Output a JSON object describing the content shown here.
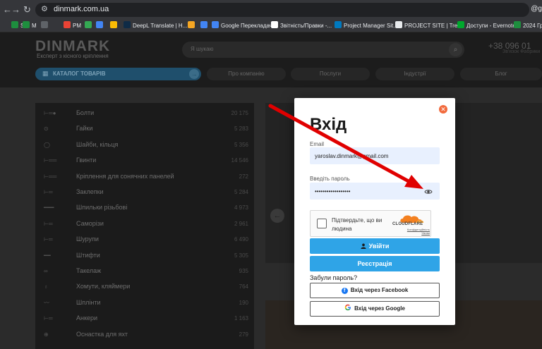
{
  "browser": {
    "url": "dinmark.com.ua",
    "account_label": "@g",
    "bookmarks": [
      {
        "label": "R",
        "color": "#35363a"
      },
      {
        "label": "S",
        "color": "#1e8e3e"
      },
      {
        "label": "M",
        "color": "#1e8e3e"
      },
      {
        "label": "",
        "color": "#5f6368"
      },
      {
        "label": "PM",
        "color": "#ea4335"
      },
      {
        "label": "",
        "color": "#34a853"
      },
      {
        "label": "",
        "color": "#4285f4"
      },
      {
        "label": "",
        "color": "#fbbc04"
      },
      {
        "label": "DeepL Translate | H...",
        "color": "#0f2b46"
      },
      {
        "label": "",
        "color": "#f5a623"
      },
      {
        "label": "",
        "color": "#4285f4"
      },
      {
        "label": "Google Перекладач",
        "color": "#4285f4"
      },
      {
        "label": "Звітність/Правки -...",
        "color": "#ffffff"
      },
      {
        "label": "Project Manager Sit...",
        "color": "#0079bf"
      },
      {
        "label": "PROJECT SITE | Trello",
        "color": "#e8eaed"
      },
      {
        "label": "Доступи - Evernote",
        "color": "#00a82d"
      },
      {
        "label": "2024 Граф",
        "color": "#1e8e3e"
      }
    ]
  },
  "site": {
    "logo": "DINMARK",
    "tagline": "Експерт з кісного кріплення",
    "search_placeholder": "Я шукаю",
    "phone": "+38 096 01",
    "phone_sub": "Зв'язок Фабрики",
    "catalog_label": "КАТАЛОГ ТОВАРІВ",
    "nav": [
      "Про компанію",
      "Послуги",
      "Індустрії",
      "Блог"
    ],
    "categories": [
      {
        "name": "Болти",
        "count": "20 175"
      },
      {
        "name": "Гайки",
        "count": "5 283"
      },
      {
        "name": "Шайби, кільця",
        "count": "5 356"
      },
      {
        "name": "Гвинти",
        "count": "14 546"
      },
      {
        "name": "Кріплення для сонячних панелей",
        "count": "272"
      },
      {
        "name": "Заклепки",
        "count": "5 284"
      },
      {
        "name": "Шпильки різьбові",
        "count": "4 973"
      },
      {
        "name": "Саморізи",
        "count": "2 961"
      },
      {
        "name": "Шурупи",
        "count": "6 490"
      },
      {
        "name": "Штифти",
        "count": "5 305"
      },
      {
        "name": "Такелаж",
        "count": "935"
      },
      {
        "name": "Хомути, кляймери",
        "count": "764"
      },
      {
        "name": "Шплінти",
        "count": "190"
      },
      {
        "name": "Анкери",
        "count": "1 163"
      },
      {
        "name": "Оснастка для яхт",
        "count": "279"
      }
    ]
  },
  "modal": {
    "title": "Вхід",
    "email_label": "Email",
    "email_value": "yaroslav.dinmark@gmail.com",
    "password_label": "Введіть пароль",
    "password_value": "••••••••••••••••••",
    "captcha_text": "Підтвердьте, що ви людина",
    "cloudflare_name": "CLOUDFLARE",
    "cloudflare_links": "Конфіденційність Умови",
    "login_label": "Увійти",
    "register_label": "Реєстрація",
    "forgot_label": "Забули пароль?",
    "facebook_label": "Вхід через Facebook",
    "google_label": "Вхід через Google"
  },
  "colors": {
    "accent_blue": "#2fa4e7",
    "close_orange": "#f26a3d",
    "annotation_red": "#e00000",
    "input_bg": "#e8f0fe"
  }
}
